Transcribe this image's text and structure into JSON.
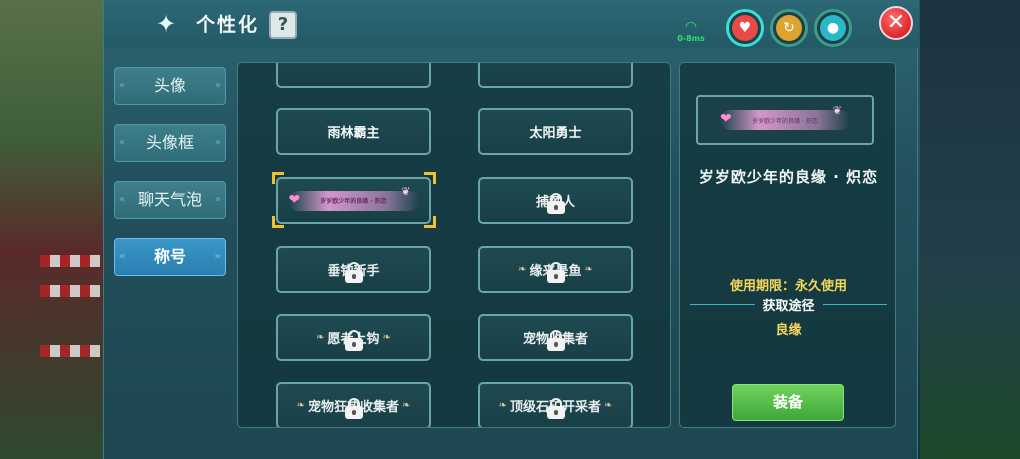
{
  "header": {
    "title": "个性化",
    "help_label": "?",
    "network": {
      "signal_icon": "wifi-icon",
      "ping_text": "0-8ms",
      "color": "#2ee06a"
    },
    "close_label": "✕",
    "status_icons": [
      "heart-icon",
      "stamina-icon",
      "water-drop-icon"
    ]
  },
  "sidebar": {
    "items": [
      {
        "label": "头像",
        "active": false
      },
      {
        "label": "头像框",
        "active": false
      },
      {
        "label": "聊天气泡",
        "active": false
      },
      {
        "label": "称号",
        "active": true
      }
    ]
  },
  "titles": {
    "cards": [
      {
        "label": "",
        "locked": false,
        "partial": true
      },
      {
        "label": "",
        "locked": false,
        "partial": true
      },
      {
        "label": "雨林霸主",
        "locked": false
      },
      {
        "label": "太阳勇士",
        "locked": false
      },
      {
        "label": "",
        "locked": false,
        "selected": true,
        "banner": true
      },
      {
        "label": "捕梦人",
        "locked": true
      },
      {
        "label": "垂钓新手",
        "locked": true
      },
      {
        "label": "缘来是鱼",
        "locked": true,
        "leaves": true
      },
      {
        "label": "愿者上钩",
        "locked": true,
        "leaves": true
      },
      {
        "label": "宠物收集者",
        "locked": true
      },
      {
        "label": "宠物狂热收集者",
        "locked": true,
        "leaves": true
      },
      {
        "label": "顶级石矿开采者",
        "locked": true,
        "leaves": true
      }
    ]
  },
  "detail": {
    "name": "岁岁欧少年的良缘 · 炽恋",
    "usage_text": "使用期限：永久使用",
    "obtain_label": "获取途径",
    "obtain_source": "良缘",
    "equip_label": "装备"
  },
  "colors": {
    "accent_yellow": "#f6d75a",
    "selected_frame": "#f2c02b",
    "equip_green": "#4fbe45",
    "tab_active": "#3a97c8"
  }
}
